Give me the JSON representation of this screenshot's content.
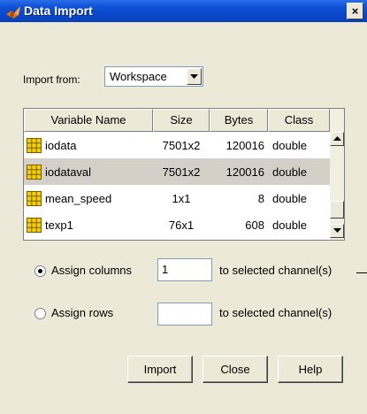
{
  "window": {
    "title": "Data Import",
    "close_glyph": "×"
  },
  "import_from": {
    "label": "Import from:",
    "selected": "Workspace"
  },
  "table": {
    "columns": [
      "Variable Name",
      "Size",
      "Bytes",
      "Class"
    ],
    "rows": [
      {
        "name": "iodata",
        "size": "7501x2",
        "bytes": "120016",
        "class": "double",
        "selected": false
      },
      {
        "name": "iodataval",
        "size": "7501x2",
        "bytes": "120016",
        "class": "double",
        "selected": true
      },
      {
        "name": "mean_speed",
        "size": "1x1",
        "bytes": "8",
        "class": "double",
        "selected": false
      },
      {
        "name": "texp1",
        "size": "76x1",
        "bytes": "608",
        "class": "double",
        "selected": false
      }
    ]
  },
  "assign_columns": {
    "label": "Assign columns",
    "value": "1",
    "suffix": "to selected channel(s)",
    "checked": true
  },
  "assign_rows": {
    "label": "Assign rows",
    "value": "",
    "suffix": "to selected channel(s)",
    "checked": false
  },
  "buttons": {
    "import": "Import",
    "close": "Close",
    "help": "Help"
  },
  "colors": {
    "titlebar": "#0a47c8",
    "dialog_bg": "#ece9d8",
    "selected_row": "#d4d0c8",
    "variable_icon": "#f5d000"
  },
  "icons": {
    "title": "matlab-icon",
    "variable": "grid-variable-icon"
  }
}
